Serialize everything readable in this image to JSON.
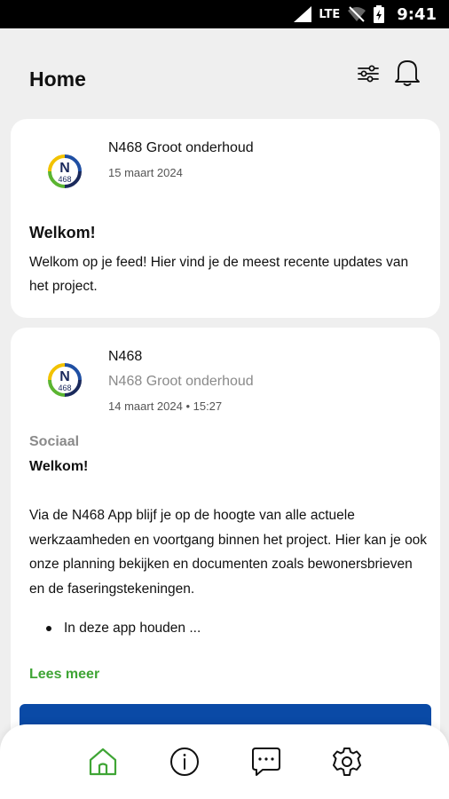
{
  "status_bar": {
    "network": "LTE",
    "time": "9:41"
  },
  "header": {
    "title": "Home",
    "icons": [
      "filter-icon",
      "bell-icon"
    ]
  },
  "feed": [
    {
      "author": "N468 Groot onderhoud",
      "date": "15 maart 2024",
      "heading": "Welkom!",
      "body": "Welkom op je feed! Hier vind je de meest recente updates van het project."
    },
    {
      "author": "N468",
      "subtitle": "N468 Groot onderhoud",
      "date": "14 maart 2024 • 15:27",
      "category": "Sociaal",
      "heading": "Welkom!",
      "body": "Via de N468 App blijf je op de hoogte van alle actuele werkzaamheden en voortgang binnen het project. Hier kan je ook onze planning bekijken en documenten zoals bewonersbrieven en de faseringstekeningen.",
      "bullet": "In deze app houden ...",
      "read_more": "Lees meer"
    }
  ],
  "logo": {
    "line1": "N",
    "line2": "468"
  },
  "bottom_nav": {
    "items": [
      "home-icon",
      "info-icon",
      "chat-icon",
      "settings-icon"
    ],
    "active": "home-icon"
  },
  "colors": {
    "accent_green": "#3fa535",
    "cta_blue": "#0a4aa6",
    "logo_yellow": "#f2c200",
    "logo_blue": "#1f4fa3",
    "logo_navy": "#1b2a5c",
    "logo_green": "#5bb531"
  }
}
